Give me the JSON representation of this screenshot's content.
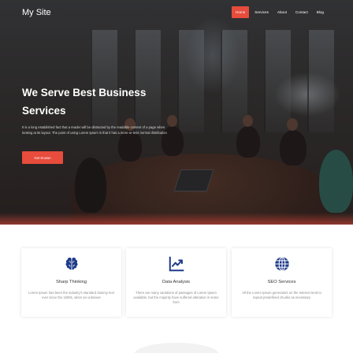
{
  "brand": {
    "name": "My Site"
  },
  "nav": {
    "items": [
      {
        "label": "Home",
        "active": true
      },
      {
        "label": "Services",
        "active": false
      },
      {
        "label": "About",
        "active": false
      },
      {
        "label": "Contact",
        "active": false
      },
      {
        "label": "Blog",
        "active": false
      }
    ]
  },
  "hero": {
    "title": "We Serve Best Business Services",
    "description": "It is a long established fact that a reader will be distracted by the readable content of a page when looking at its layout. The point of using Lorem Ipsum is that it has a more-or-less normal distribution",
    "button_label": "Get Known"
  },
  "services": {
    "cards": [
      {
        "icon": "brain-icon",
        "title": "Sharp Thinking",
        "text": "Lorem Ipsum has been the industry's standard dummy text ever since the 1500s, when an unknown"
      },
      {
        "icon": "chart-line-icon",
        "title": "Data Analysis",
        "text": "There are many variations of passages of Lorem Ipsum available, but the majority have suffered alteration in some form"
      },
      {
        "icon": "globe-icon",
        "title": "SEO Services",
        "text": "All the Lorem Ipsum generators on the Internet tend to repeat predefined chunks as necessary"
      }
    ]
  },
  "colors": {
    "accent": "#e74c3c",
    "icon": "#1e3a8a"
  }
}
